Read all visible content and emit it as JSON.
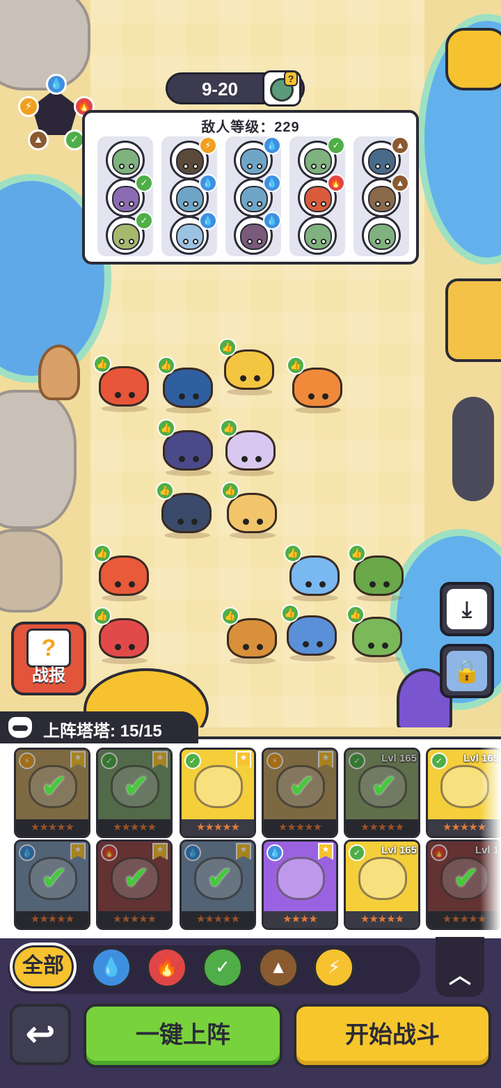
{
  "stage": {
    "label": "9-20"
  },
  "enemy_panel": {
    "title": "敌人等级：229",
    "columns": [
      [
        {
          "color": "#7fb27e",
          "elem": "none"
        },
        {
          "color": "#8b6bb3",
          "elem": "leaf"
        },
        {
          "color": "#a5b86c",
          "elem": "leaf"
        }
      ],
      [
        {
          "color": "#5a4a3a",
          "elem": "bolt"
        },
        {
          "color": "#6fa6c8",
          "elem": "water"
        },
        {
          "color": "#9cc2e2",
          "elem": "water"
        }
      ],
      [
        {
          "color": "#6fa6c8",
          "elem": "water"
        },
        {
          "color": "#6fa6c8",
          "elem": "water"
        },
        {
          "color": "#7a5a7a",
          "elem": "water"
        }
      ],
      [
        {
          "color": "#7fb27e",
          "elem": "leaf"
        },
        {
          "color": "#d95b3c",
          "elem": "fire"
        },
        {
          "color": "#7fb27e",
          "elem": "none"
        }
      ],
      [
        {
          "color": "#4a6a8a",
          "elem": "earth"
        },
        {
          "color": "#8a6a4a",
          "elem": "earth"
        },
        {
          "color": "#7fb27e",
          "elem": "none"
        }
      ]
    ]
  },
  "element_wheel": [
    {
      "name": "water",
      "color": "#3f8fe0",
      "glyph": "💧"
    },
    {
      "name": "fire",
      "color": "#e04646",
      "glyph": "🔥"
    },
    {
      "name": "leaf",
      "color": "#4fae47",
      "glyph": "✓"
    },
    {
      "name": "earth",
      "color": "#8a5a30",
      "glyph": "▲"
    },
    {
      "name": "bolt",
      "color": "#f0a020",
      "glyph": "⚡"
    }
  ],
  "ally_units": [
    {
      "name": "frog",
      "color": "#e8563a"
    },
    {
      "name": "toucan",
      "color": "#2f5fa0"
    },
    {
      "name": "lion",
      "color": "#f4c540"
    },
    {
      "name": "tiger",
      "color": "#f08a3a"
    },
    {
      "name": "rhino",
      "color": "#4a4a8a"
    },
    {
      "name": "unicorn-cat",
      "color": "#d8c8f0"
    },
    {
      "name": "shark",
      "color": "#3a4a6a"
    },
    {
      "name": "fox",
      "color": "#f2c56a"
    },
    {
      "name": "phoenix",
      "color": "#e85a3a"
    },
    {
      "name": "jellyfish",
      "color": "#7ab8f0"
    },
    {
      "name": "mantis",
      "color": "#6aa84a"
    },
    {
      "name": "dragon",
      "color": "#e24a4a"
    },
    {
      "name": "weasel",
      "color": "#d8913a"
    },
    {
      "name": "ice-serpent",
      "color": "#5a90d8"
    },
    {
      "name": "flower-frog",
      "color": "#7ab85a"
    }
  ],
  "report_button": {
    "label": "战报",
    "glyph": "?"
  },
  "roster": {
    "header": "上阵塔塔: 15/15",
    "cards": [
      {
        "bg": "#f1b73a",
        "elem_color": "#f0a020",
        "elem": "⚡",
        "stars": "★★★★★",
        "crown": true,
        "level": "",
        "deployed": true,
        "dim": true
      },
      {
        "bg": "#78c45a",
        "elem_color": "#4fae47",
        "elem": "✓",
        "stars": "★★★★★",
        "crown": true,
        "level": "",
        "deployed": true,
        "dim": true
      },
      {
        "bg": "#f4cf3a",
        "elem_color": "#4fae47",
        "elem": "✓",
        "stars": "★★★★★",
        "crown": true,
        "level": "",
        "deployed": false,
        "dim": false
      },
      {
        "bg": "#f0b43a",
        "elem_color": "#f0a020",
        "elem": "⚡",
        "stars": "★★★★★",
        "crown": true,
        "level": "",
        "deployed": true,
        "dim": true
      },
      {
        "bg": "#9ac65a",
        "elem_color": "#4fae47",
        "elem": "✓",
        "stars": "★★★★★",
        "crown": false,
        "level": "Lvl 165",
        "deployed": true,
        "dim": true
      },
      {
        "bg": "#f4cf3a",
        "elem_color": "#4fae47",
        "elem": "✓",
        "stars": "★★★★★",
        "crown": false,
        "level": "Lvl 165",
        "deployed": false,
        "dim": false
      },
      {
        "bg": "#7ab0e8",
        "elem_color": "#3f8fe0",
        "elem": "💧",
        "stars": "★★★★★",
        "crown": true,
        "level": "",
        "deployed": true,
        "dim": true
      },
      {
        "bg": "#e24a4a",
        "elem_color": "#e04646",
        "elem": "🔥",
        "stars": "★★★★★",
        "crown": true,
        "level": "",
        "deployed": true,
        "dim": true
      },
      {
        "bg": "#7ab0e8",
        "elem_color": "#3f8fe0",
        "elem": "💧",
        "stars": "★★★★★",
        "crown": true,
        "level": "",
        "deployed": true,
        "dim": true
      },
      {
        "bg": "#9a62e0",
        "elem_color": "#3f8fe0",
        "elem": "💧",
        "stars": "★★★★",
        "crown": true,
        "level": "",
        "deployed": false,
        "dim": false
      },
      {
        "bg": "#f4cf3a",
        "elem_color": "#4fae47",
        "elem": "✓",
        "stars": "★★★★★",
        "crown": false,
        "level": "Lvl 165",
        "deployed": false,
        "dim": false
      },
      {
        "bg": "#e24a4a",
        "elem_color": "#e04646",
        "elem": "🔥",
        "stars": "★★★★★",
        "crown": false,
        "level": "Lvl 1",
        "deployed": true,
        "dim": true
      }
    ]
  },
  "filters": {
    "all_label": "全部",
    "chips": [
      {
        "name": "water",
        "color": "#3f8fe0",
        "glyph": "💧"
      },
      {
        "name": "fire",
        "color": "#e04646",
        "glyph": "🔥"
      },
      {
        "name": "leaf",
        "color": "#4fae47",
        "glyph": "✓"
      },
      {
        "name": "earth",
        "color": "#8a5a30",
        "glyph": "▲"
      },
      {
        "name": "bolt",
        "color": "#f6c230",
        "glyph": "⚡"
      }
    ]
  },
  "buttons": {
    "auto_deploy": "一键上阵",
    "start_battle": "开始战斗"
  },
  "colors": {
    "thumb": "#4fae47",
    "dark": "#2b2b36"
  }
}
